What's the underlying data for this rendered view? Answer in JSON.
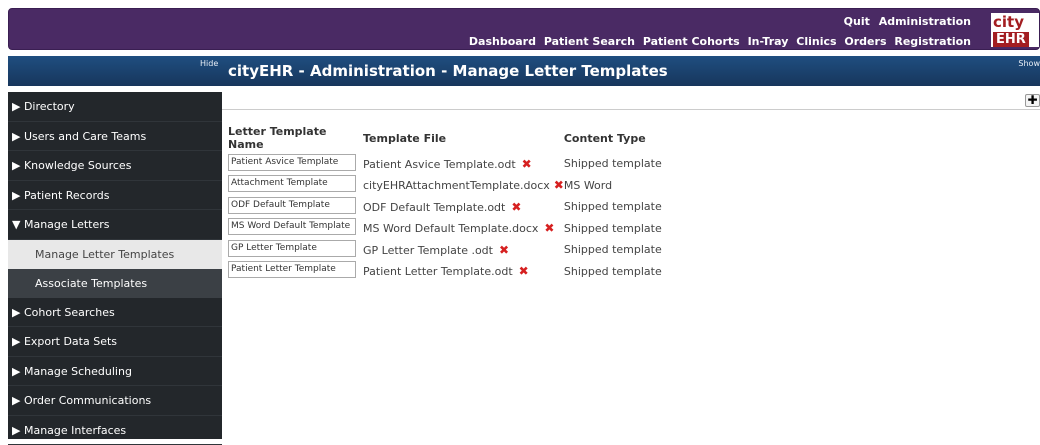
{
  "header": {
    "top_links": [
      "Quit",
      "Administration"
    ],
    "nav_links": [
      "Dashboard",
      "Patient Search",
      "Patient Cohorts",
      "In-Tray",
      "Clinics",
      "Orders",
      "Registration"
    ],
    "logo_line1": "city",
    "logo_line2": "EHR"
  },
  "titlebar": {
    "hide_label": "Hide",
    "title": "cityEHR - Administration - Manage Letter Templates",
    "show_label": "Show"
  },
  "sidebar": {
    "items": [
      {
        "label": "▶ Directory"
      },
      {
        "label": "▶ Users and Care Teams"
      },
      {
        "label": "▶ Knowledge Sources"
      },
      {
        "label": "▶ Patient Records"
      },
      {
        "label": "▼ Manage Letters"
      },
      {
        "label": "Manage Letter Templates"
      },
      {
        "label": "Associate Templates"
      },
      {
        "label": "▶ Cohort Searches"
      },
      {
        "label": "▶ Export Data Sets"
      },
      {
        "label": "▶ Manage Scheduling"
      },
      {
        "label": "▶ Order Communications"
      },
      {
        "label": "▶ Manage Interfaces"
      }
    ]
  },
  "main": {
    "add_label": "✚",
    "columns": [
      "Letter Template Name",
      "Template File",
      "Content Type"
    ],
    "rows": [
      {
        "name": "Patient Asvice Template",
        "file": "Patient Asvice Template.odt",
        "type": "Shipped template"
      },
      {
        "name": "Attachment Template",
        "file": "cityEHRAttachmentTemplate.docx",
        "type": "MS Word"
      },
      {
        "name": "ODF Default Template",
        "file": "ODF Default Template.odt",
        "type": "Shipped template"
      },
      {
        "name": "MS Word Default Template",
        "file": "MS Word Default Template.docx",
        "type": "Shipped template"
      },
      {
        "name": "GP Letter Template",
        "file": "GP Letter Template .odt",
        "type": "Shipped template"
      },
      {
        "name": "Patient Letter Template",
        "file": "Patient Letter Template.odt",
        "type": "Shipped template"
      }
    ],
    "delete_icon": "✖"
  },
  "colors": {
    "banner": "#4a2a64",
    "titlebar": "#1f4e80",
    "sidebar": "#23272b",
    "logo_red": "#a31e22",
    "delete_red": "#d62020"
  }
}
